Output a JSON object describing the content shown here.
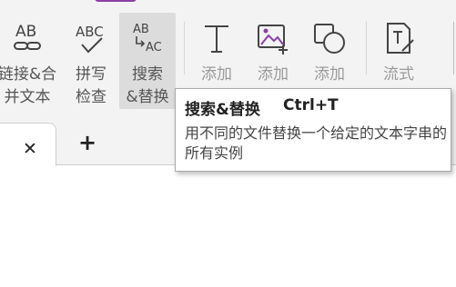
{
  "ribbon": {
    "buttons": [
      {
        "id": "merge",
        "label_line1": "链接&合",
        "label_line2": "并文本",
        "icon": "link-merge-icon",
        "icon_text": "AB"
      },
      {
        "id": "spell",
        "label_line1": "拼写",
        "label_line2": "检查",
        "icon": "spell-check-icon",
        "icon_text": "ABC"
      },
      {
        "id": "replace",
        "label_line1": "搜索",
        "label_line2": "&替换",
        "icon": "search-replace-icon",
        "icon_text_a": "AB",
        "icon_text_b": "AC"
      },
      {
        "id": "add-text",
        "label_line1": "添加",
        "icon": "text-icon"
      },
      {
        "id": "add-image",
        "label_line1": "添加",
        "icon": "image-add-icon"
      },
      {
        "id": "add-shape",
        "label_line1": "添加",
        "icon": "shape-icon"
      },
      {
        "id": "flow",
        "label_line1": "流式",
        "icon": "flow-text-icon"
      }
    ]
  },
  "tooltip": {
    "title": "搜索&替换",
    "shortcut": "Ctrl+T",
    "description": "用不同的文件替换一个给定的文本字串的所有实例"
  },
  "colors": {
    "accent": "#8b3fa6",
    "ribbon_bg": "#f3f3f3",
    "active_bg": "#dcdcdc"
  }
}
